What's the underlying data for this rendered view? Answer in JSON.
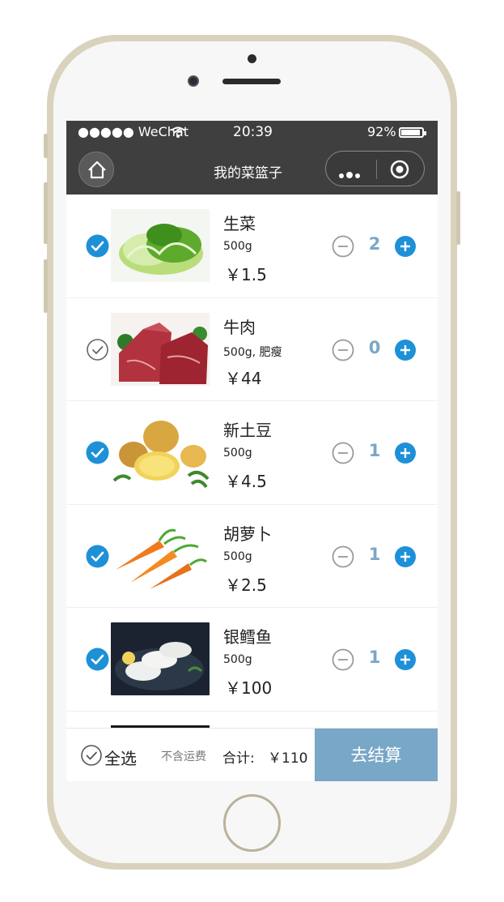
{
  "status_bar": {
    "carrier": "●●●●● WeChat",
    "time": "20:39",
    "battery_percent": "92%",
    "battery_level": 0.92
  },
  "nav": {
    "title": "我的菜篮子",
    "home_icon": "home-icon",
    "menu_icon": "more-dots-icon",
    "close_icon": "target-circle-icon"
  },
  "cart": {
    "items": [
      {
        "name": "生菜",
        "spec": "500g",
        "price": "￥1.5",
        "qty": "2",
        "selected": true,
        "image": "lettuce"
      },
      {
        "name": "牛肉",
        "spec": "500g, 肥瘦",
        "price": "￥44",
        "qty": "0",
        "selected": false,
        "image": "beef"
      },
      {
        "name": "新土豆",
        "spec": "500g",
        "price": "￥4.5",
        "qty": "1",
        "selected": true,
        "image": "potato"
      },
      {
        "name": "胡萝卜",
        "spec": "500g",
        "price": "￥2.5",
        "qty": "1",
        "selected": true,
        "image": "carrot"
      },
      {
        "name": "银鳕鱼",
        "spec": "500g",
        "price": "￥100",
        "qty": "1",
        "selected": true,
        "image": "cod"
      }
    ]
  },
  "footer": {
    "select_all_label": "全选",
    "shipping_note": "不含运费",
    "total_label": "合计:",
    "total_value": "￥110",
    "checkout_label": "去结算"
  },
  "colors": {
    "accent": "#1e90d8",
    "qty_text": "#7ba7c7",
    "checkout_bg": "#78a7c7",
    "nav_bg": "#3f3f3f"
  }
}
